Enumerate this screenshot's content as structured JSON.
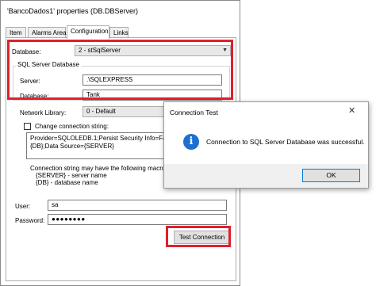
{
  "window": {
    "title": "'BancoDados1' properties (DB.DBServer)"
  },
  "tabs": [
    {
      "label": "Item"
    },
    {
      "label": "Alarms Area"
    },
    {
      "label": "Configuration"
    },
    {
      "label": "Links"
    }
  ],
  "config": {
    "database_label": "Database:",
    "database_value": "2 - stSqlServer",
    "group_title": "SQL Server Database",
    "server_label": "Server:",
    "server_value": ".\\SQLEXPRESS",
    "dbname_label": "Database:",
    "dbname_value": "Tank",
    "network_label": "Network Library:",
    "network_value": "0 - Default",
    "change_conn_label": "Change connection string:",
    "conn_string": "Provider=SQLOLEDB.1;Persist Security Info=False;Initial Catalog={DB};Data Source={SERVER}",
    "macros_text": "Connection string may have the following macros:",
    "macro_server": "{SERVER} - server name",
    "macro_db": "{DB} - database name",
    "user_label": "User:",
    "user_value": "sa",
    "password_label": "Password:",
    "password_value": "●●●●●●●●",
    "test_button": "Test Connection"
  },
  "dialog": {
    "title": "Connection Test",
    "close_glyph": "✕",
    "icon_glyph": "i",
    "message": "Connection to SQL Server Database was successful.",
    "ok_label": "OK"
  },
  "colors": {
    "highlight": "#e0202b",
    "info_icon": "#1e6fd0",
    "focus_border": "#0078d7"
  }
}
